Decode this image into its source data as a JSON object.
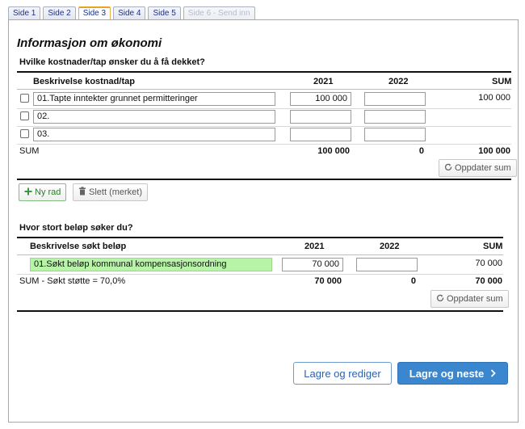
{
  "tabs": [
    {
      "label": "Side 1",
      "state": "normal"
    },
    {
      "label": "Side 2",
      "state": "normal"
    },
    {
      "label": "Side 3",
      "state": "active"
    },
    {
      "label": "Side 4",
      "state": "normal"
    },
    {
      "label": "Side 5",
      "state": "normal"
    },
    {
      "label": "Side 6 - Send inn",
      "state": "disabled"
    }
  ],
  "page_title": "Informasjon om økonomi",
  "costs": {
    "question": "Hvilke kostnader/tap ønsker du å få dekket?",
    "headers": {
      "desc": "Beskrivelse kostnad/tap",
      "y2021": "2021",
      "y2022": "2022",
      "sum": "SUM"
    },
    "rows": [
      {
        "desc": "01.Tapte inntekter grunnet permitteringer",
        "y2021": "100 000",
        "y2022": "",
        "sum": "100 000"
      },
      {
        "desc": "02.",
        "y2021": "",
        "y2022": "",
        "sum": ""
      },
      {
        "desc": "03.",
        "y2021": "",
        "y2022": "",
        "sum": ""
      }
    ],
    "total": {
      "label": "SUM",
      "y2021": "100 000",
      "y2022": "0",
      "sum": "100 000"
    },
    "update_label": "Oppdater sum",
    "add_label": "Ny rad",
    "delete_label": "Slett (merket)"
  },
  "amount": {
    "question": "Hvor stort beløp søker du?",
    "headers": {
      "desc": "Beskrivelse søkt beløp",
      "y2021": "2021",
      "y2022": "2022",
      "sum": "SUM"
    },
    "rows": [
      {
        "desc": "01.Søkt beløp kommunal kompensasjonsordning",
        "y2021": "70 000",
        "y2022": "",
        "sum": "70 000"
      }
    ],
    "total": {
      "label": "SUM  - Søkt støtte = 70,0%",
      "y2021": "70 000",
      "y2022": "0",
      "sum": "70 000"
    },
    "update_label": "Oppdater sum"
  },
  "footer": {
    "save_edit_label": "Lagre og rediger",
    "save_next_label": "Lagre og neste"
  },
  "colors": {
    "primary": "#3a87cf",
    "active_tab_border": "#e8a321",
    "highlight_input": "#b7f4a8",
    "add_button_green": "#2a7a2a"
  }
}
